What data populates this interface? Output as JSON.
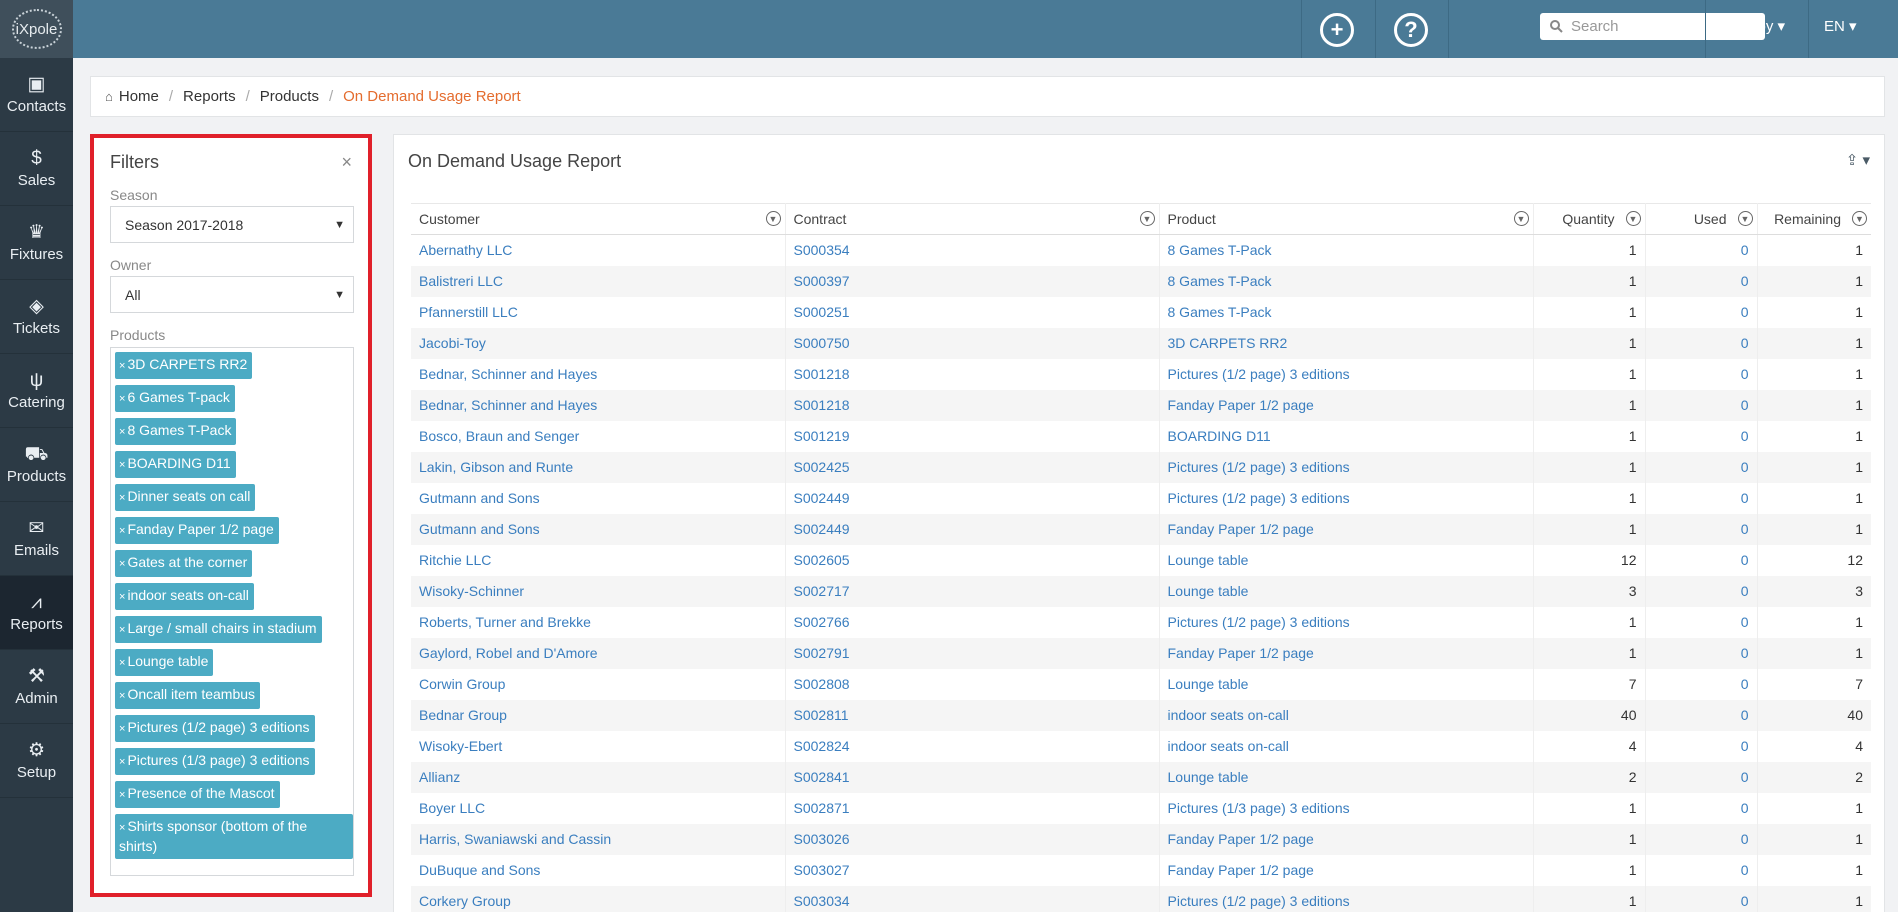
{
  "brand": {
    "logo_text": "iXpole"
  },
  "sidebar": {
    "items": [
      {
        "label": "Contacts",
        "icon": "contacts-icon",
        "glyph": "▣"
      },
      {
        "label": "Sales",
        "icon": "dollar-icon",
        "glyph": "$"
      },
      {
        "label": "Fixtures",
        "icon": "trophy-icon",
        "glyph": "♛"
      },
      {
        "label": "Tickets",
        "icon": "ticket-icon",
        "glyph": "◈"
      },
      {
        "label": "Catering",
        "icon": "cutlery-icon",
        "glyph": "ψ"
      },
      {
        "label": "Products",
        "icon": "cart-icon",
        "glyph": "⛟"
      },
      {
        "label": "Emails",
        "icon": "envelope-icon",
        "glyph": "✉"
      },
      {
        "label": "Reports",
        "icon": "chart-icon",
        "glyph": "⩘"
      },
      {
        "label": "Admin",
        "icon": "tools-icon",
        "glyph": "⚒"
      },
      {
        "label": "Setup",
        "icon": "gears-icon",
        "glyph": "⚙"
      }
    ],
    "active": "Reports"
  },
  "topbar": {
    "add_glyph": "+",
    "help_glyph": "?",
    "search_placeholder": "Search",
    "user": "Robby ▾",
    "language": "EN ▾"
  },
  "breadcrumb": {
    "home": "Home",
    "reports": "Reports",
    "products": "Products",
    "current": "On Demand Usage Report",
    "sep": "/"
  },
  "filters": {
    "title": "Filters",
    "close": "×",
    "season_label": "Season",
    "season_value": "Season 2017-2018",
    "owner_label": "Owner",
    "owner_value": "All",
    "products_label": "Products",
    "products": [
      "3D CARPETS RR2",
      "6 Games T-pack",
      "8 Games T-Pack",
      "BOARDING D11",
      "Dinner seats on call",
      "Fanday Paper 1/2 page",
      "Gates at the corner",
      "indoor seats on-call",
      "Large / small chairs in stadium",
      "Lounge table",
      "Oncall item teambus",
      "Pictures (1/2 page) 3 editions",
      "Pictures (1/3 page) 3 editions",
      "Presence of the Mascot",
      "Shirts sponsor (bottom of the shirts)"
    ]
  },
  "report": {
    "title": "On Demand Usage Report",
    "export_label": "⇪ ▾",
    "columns": [
      "Customer",
      "Contract",
      "Product",
      "Quantity",
      "Used",
      "Remaining"
    ],
    "rows": [
      [
        "Abernathy LLC",
        "S000354",
        "8 Games T-Pack",
        "1",
        "0",
        "1"
      ],
      [
        "Balistreri LLC",
        "S000397",
        "8 Games T-Pack",
        "1",
        "0",
        "1"
      ],
      [
        "Pfannerstill LLC",
        "S000251",
        "8 Games T-Pack",
        "1",
        "0",
        "1"
      ],
      [
        "Jacobi-Toy",
        "S000750",
        "3D CARPETS RR2",
        "1",
        "0",
        "1"
      ],
      [
        "Bednar, Schinner and Hayes",
        "S001218",
        "Pictures (1/2 page) 3 editions",
        "1",
        "0",
        "1"
      ],
      [
        "Bednar, Schinner and Hayes",
        "S001218",
        "Fanday Paper 1/2 page",
        "1",
        "0",
        "1"
      ],
      [
        "Bosco, Braun and Senger",
        "S001219",
        "BOARDING D11",
        "1",
        "0",
        "1"
      ],
      [
        "Lakin, Gibson and Runte",
        "S002425",
        "Pictures (1/2 page) 3 editions",
        "1",
        "0",
        "1"
      ],
      [
        "Gutmann and Sons",
        "S002449",
        "Pictures (1/2 page) 3 editions",
        "1",
        "0",
        "1"
      ],
      [
        "Gutmann and Sons",
        "S002449",
        "Fanday Paper 1/2 page",
        "1",
        "0",
        "1"
      ],
      [
        "Ritchie LLC",
        "S002605",
        "Lounge table",
        "12",
        "0",
        "12"
      ],
      [
        "Wisoky-Schinner",
        "S002717",
        "Lounge table",
        "3",
        "0",
        "3"
      ],
      [
        "Roberts, Turner and Brekke",
        "S002766",
        "Pictures (1/2 page) 3 editions",
        "1",
        "0",
        "1"
      ],
      [
        "Gaylord, Robel and D'Amore",
        "S002791",
        "Fanday Paper 1/2 page",
        "1",
        "0",
        "1"
      ],
      [
        "Corwin Group",
        "S002808",
        "Lounge table",
        "7",
        "0",
        "7"
      ],
      [
        "Bednar Group",
        "S002811",
        "indoor seats on-call",
        "40",
        "0",
        "40"
      ],
      [
        "Wisoky-Ebert",
        "S002824",
        "indoor seats on-call",
        "4",
        "0",
        "4"
      ],
      [
        "Allianz",
        "S002841",
        "Lounge table",
        "2",
        "0",
        "2"
      ],
      [
        "Boyer LLC",
        "S002871",
        "Pictures (1/3 page) 3 editions",
        "1",
        "0",
        "1"
      ],
      [
        "Harris, Swaniawski and Cassin",
        "S003026",
        "Fanday Paper 1/2 page",
        "1",
        "0",
        "1"
      ],
      [
        "DuBuque and Sons",
        "S003027",
        "Fanday Paper 1/2 page",
        "1",
        "0",
        "1"
      ],
      [
        "Corkery Group",
        "S003034",
        "Pictures (1/2 page) 3 editions",
        "1",
        "0",
        "1"
      ]
    ]
  },
  "colors": {
    "sidebar_bg": "#2c3a45",
    "topbar_bg": "#4a7a96",
    "tag_bg": "#4cabc4",
    "link": "#3a7ebf",
    "breadcrumb_current": "#e46c2e",
    "filter_outline": "#e0202a"
  }
}
